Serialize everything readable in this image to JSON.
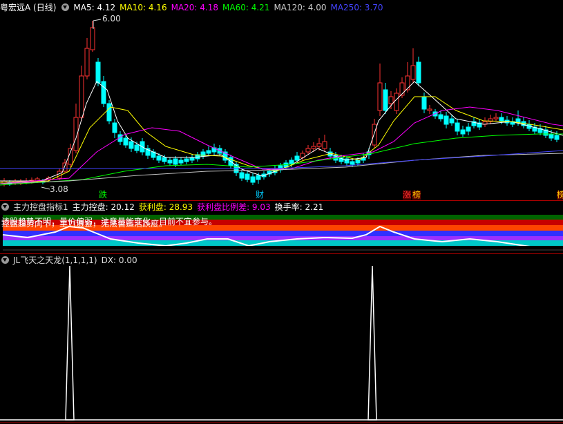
{
  "main_panel": {
    "title": "粤宏远A (日线)",
    "ma_items": [
      {
        "label": "MA5: 4.12",
        "color": "#ffffff"
      },
      {
        "label": "MA10: 4.16",
        "color": "#ffff00"
      },
      {
        "label": "MA20: 4.18",
        "color": "#ff00ff"
      },
      {
        "label": "MA60: 4.21",
        "color": "#00ff00"
      },
      {
        "label": "MA120: 4.00",
        "color": "#cccccc"
      },
      {
        "label": "MA250: 3.70",
        "color": "#4444ff"
      }
    ],
    "high_label": "6.00",
    "low_label": "3.08",
    "markers": [
      {
        "text": "跌",
        "color": "#00ff00"
      },
      {
        "text": "财",
        "color": "#00ccff"
      },
      {
        "text": "涨",
        "color": "#ff3333"
      },
      {
        "text": "榜",
        "color": "#ffcc00"
      },
      {
        "text": "榜",
        "color": "#ffcc00"
      }
    ]
  },
  "indicator1": {
    "name": "主力控盘指标1",
    "items": [
      {
        "label": "主力控盘: 20.12",
        "color": "#ffffff"
      },
      {
        "label": "获利盘: 28.93",
        "color": "#ffff00"
      },
      {
        "label": "获利盘比例差: 9.03",
        "color": "#ff00ff"
      },
      {
        "label": "换手率: 2.21",
        "color": "#ffffff"
      }
    ],
    "overlay_texts": [
      "该股趋势不明，量价偏弱，注意量能变化，目前不宜参与。",
      "控盘趋势向下，主力资金，无法营造活跃度。"
    ]
  },
  "indicator2": {
    "name": "JL飞天之天龙(1,1,1,1)",
    "value_label": "DX: 0.00"
  }
}
